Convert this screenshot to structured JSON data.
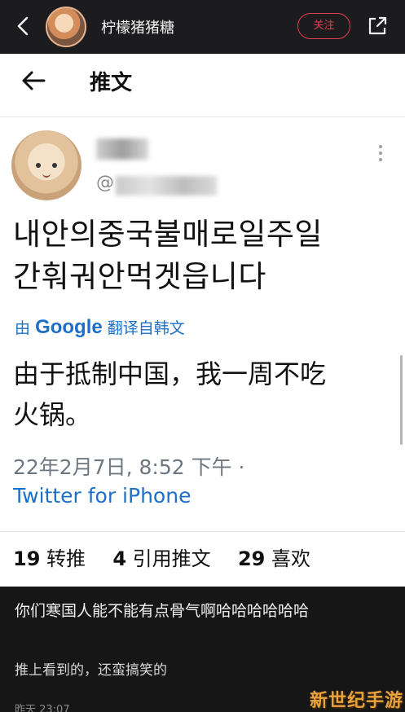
{
  "appbar": {
    "title": "柠檬猪猪糖",
    "follow_label": "关注"
  },
  "tweet_page": {
    "header_title": "推文",
    "handle_prefix": "@",
    "korean_text_line1": "내안의중국불매로일주일",
    "korean_text_line2": "간훠궈안먹겟읍니다",
    "translate_prefix": "由",
    "translate_brand": "Google",
    "translate_suffix": "翻译自韩文",
    "translated_line1": "由于抵制中国，我一周不吃",
    "translated_line2": "火锅。",
    "timestamp": "22年2月7日, 8:52 下午 ·",
    "source": "Twitter for iPhone",
    "stats": {
      "retweets_count": "19",
      "retweets_label": "转推",
      "quotes_count": "4",
      "quotes_label": "引用推文",
      "likes_count": "29",
      "likes_label": "喜欢"
    }
  },
  "caption": {
    "text": "你们寒国人能不能有点骨气啊哈哈哈哈哈哈",
    "subtext": "推上看到的，还蛮搞笑的",
    "date": "昨天 23:07"
  },
  "watermark": "新世纪手游",
  "colors": {
    "follow_accent": "#e0414f",
    "link_blue": "#1d6fc8",
    "bar_bg": "#1c1c1e"
  },
  "icons": [
    "chevron-left-icon",
    "share-icon",
    "arrow-left-icon",
    "more-vertical-icon"
  ]
}
